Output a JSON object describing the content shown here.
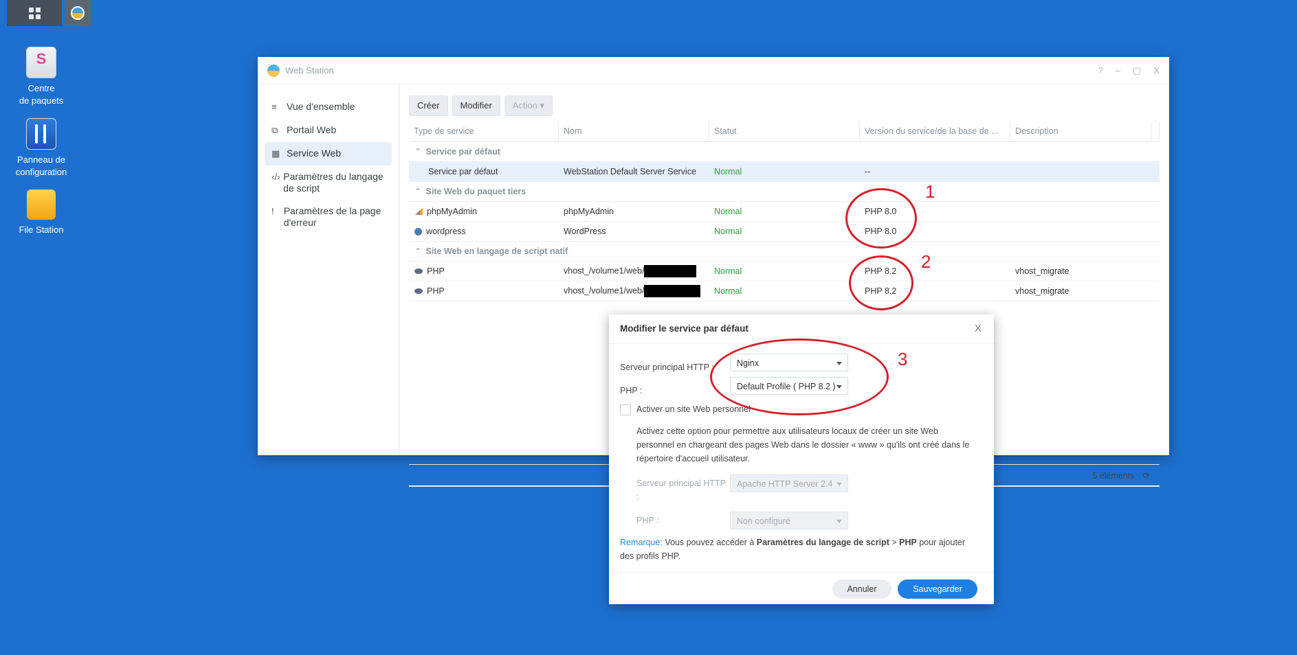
{
  "desktop": {
    "icons": [
      {
        "line1": "Centre",
        "line2": "de paquets"
      },
      {
        "line1": "Panneau de",
        "line2": "configuration"
      },
      {
        "line1": "File Station",
        "line2": ""
      }
    ]
  },
  "window": {
    "title": "Web Station",
    "controls": [
      "?",
      "–",
      "▢",
      "X"
    ]
  },
  "sidebar": {
    "items": [
      {
        "label": "Vue d'ensemble",
        "icon": "≡"
      },
      {
        "label": "Portail Web",
        "icon": "⧉"
      },
      {
        "label": "Service Web",
        "icon": "▦"
      },
      {
        "label": "Paramètres du langage de script",
        "icon": "‹/›"
      },
      {
        "label": "Paramètres de la page d'erreur",
        "icon": "!"
      }
    ]
  },
  "toolbar": {
    "create": "Créer",
    "modify": "Modifier",
    "action": "Action ▾"
  },
  "table": {
    "headers": [
      "Type de service",
      "Nom",
      "Statut",
      "Version du service/de la base de ...",
      "Description"
    ],
    "groups": [
      {
        "title": "Service par défaut",
        "rows": [
          {
            "type": "Service par défaut",
            "name": "WebStation Default Server Service",
            "status": "Normal",
            "version": "--",
            "description": ""
          }
        ]
      },
      {
        "title": "Site Web du paquet tiers",
        "rows": [
          {
            "type": "phpMyAdmin",
            "name": "phpMyAdmin",
            "status": "Normal",
            "version": "PHP 8.0",
            "description": ""
          },
          {
            "type": "wordpress",
            "name": "WordPress",
            "status": "Normal",
            "version": "PHP 8.0",
            "description": ""
          }
        ]
      },
      {
        "title": "Site Web en langage de script natif",
        "rows": [
          {
            "type": "PHP",
            "name": "vhost_/volume1/web/",
            "status": "Normal",
            "version": "PHP 8.2",
            "description": "vhost_migrate"
          },
          {
            "type": "PHP",
            "name": "vhost_/volume1/web/",
            "status": "Normal",
            "version": "PHP 8.2",
            "description": "vhost_migrate"
          }
        ]
      }
    ],
    "count": "5 éléments"
  },
  "annotations": [
    "1",
    "2",
    "3"
  ],
  "dialog": {
    "title": "Modifier le service par défaut",
    "close": "X",
    "http_label": "Serveur principal HTTP :",
    "http_value": "Nginx",
    "php_label": "PHP :",
    "php_value": "Default Profile ( PHP 8.2 )",
    "personal_checkbox": "Activer un site Web personnel",
    "personal_desc_1": "Activez cette option pour permettre aux utilisateurs locaux de créer un site Web",
    "personal_desc_2": "personnel en chargeant des pages Web dans le dossier « www » qu'ils ont créé dans le",
    "personal_desc_3": "répertoire d'accueil utilisateur.",
    "sub_http_label_1": "Serveur principal HTTP",
    "sub_http_label_2": ":",
    "sub_http_value": "Apache HTTP Server 2.4",
    "sub_php_label": "PHP :",
    "sub_php_value": "Non configuré",
    "remark_key": "Remarque:",
    "remark_text_1": " Vous pouvez accéder à ",
    "remark_bold_1": "Paramètres du langage de script",
    "remark_text_2": " > ",
    "remark_bold_2": "PHP",
    "remark_text_3": " pour ajouter",
    "remark_line_2": "des profils PHP.",
    "cancel": "Annuler",
    "save": "Sauvegarder"
  },
  "colors": {
    "desktop": "#1d70cf",
    "accent": "#1e7fe0",
    "status_ok": "#2f9d3b",
    "annotation": "#d3212d"
  }
}
